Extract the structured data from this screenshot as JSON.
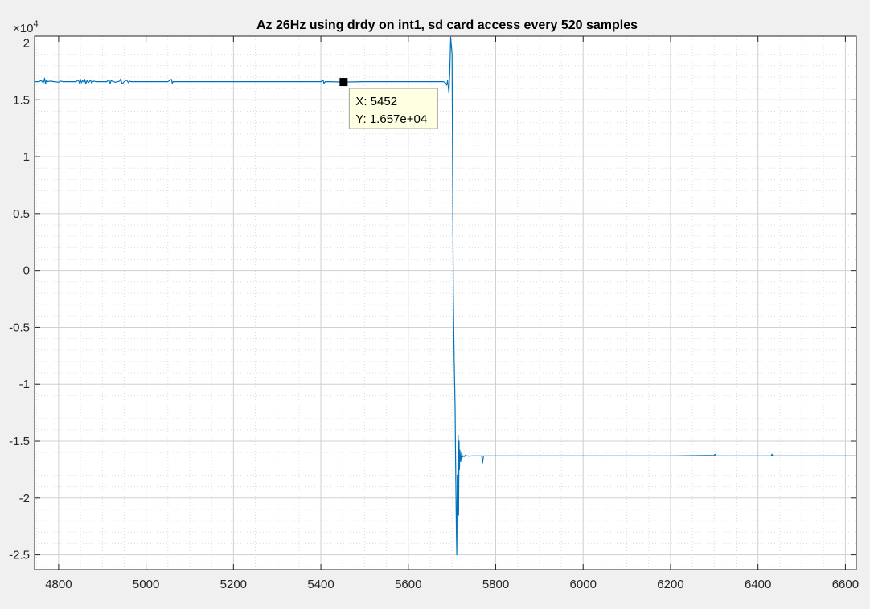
{
  "chart_data": {
    "type": "line",
    "title": "Az 26Hz using drdy on int1, sd card access every 520 samples",
    "xlabel": "",
    "ylabel": "",
    "xlim": [
      4745,
      6625
    ],
    "ylim": [
      -26300,
      20600
    ],
    "y_exponent_label": "×10",
    "y_exponent_power": "4",
    "grid": true,
    "minor_grid": true,
    "line_color": "#0072bd",
    "x_ticks": [
      4800,
      5000,
      5200,
      5400,
      5600,
      5800,
      6000,
      6200,
      6400,
      6600
    ],
    "x_tick_labels": [
      "4800",
      "5000",
      "5200",
      "5400",
      "5600",
      "5800",
      "6000",
      "6200",
      "6400",
      "6600"
    ],
    "y_ticks": [
      20000,
      15000,
      10000,
      5000,
      0,
      -5000,
      -10000,
      -15000,
      -20000,
      -25000
    ],
    "y_tick_labels": [
      "2",
      "1.5",
      "1",
      "0.5",
      "0",
      "-0.5",
      "-1",
      "-1.5",
      "-2",
      "-2.5"
    ],
    "series": [
      {
        "x": [
          4745,
          4755,
          4760,
          4765,
          4768,
          4770,
          4772,
          4775,
          4780,
          4790,
          4800,
          4805,
          4810,
          4815,
          4825,
          4840,
          4845,
          4848,
          4850,
          4852,
          4855,
          4858,
          4860,
          4862,
          4865,
          4868,
          4870,
          4873,
          4875,
          4880,
          4885,
          4900,
          4910,
          4915,
          4918,
          4920,
          4925,
          4930,
          4935,
          4940,
          4942,
          4945,
          4950,
          4955,
          4960,
          4962,
          4965,
          4970,
          4980,
          5000,
          5050,
          5058,
          5060,
          5062,
          5070,
          5100,
          5200,
          5300,
          5400,
          5405,
          5407,
          5410,
          5420,
          5452,
          5500,
          5600,
          5650,
          5680,
          5685,
          5688,
          5690,
          5693,
          5695,
          5697,
          5700,
          5701,
          5702,
          5703,
          5704,
          5705,
          5707,
          5708,
          5710,
          5711,
          5712,
          5713,
          5714,
          5715,
          5716,
          5717,
          5718,
          5720,
          5722,
          5724,
          5726,
          5728,
          5730,
          5735,
          5740,
          5745,
          5750,
          5760,
          5768,
          5770,
          5772,
          5780,
          5800,
          5900,
          6000,
          6100,
          6200,
          6300,
          6302,
          6304,
          6310,
          6400,
          6430,
          6432,
          6434,
          6440,
          6500,
          6600,
          6625
        ],
        "values": [
          16600,
          16600,
          16700,
          16500,
          16900,
          16400,
          16750,
          16600,
          16650,
          16600,
          16550,
          16650,
          16600,
          16600,
          16600,
          16600,
          16750,
          16450,
          16800,
          16500,
          16700,
          16550,
          16800,
          16400,
          16700,
          16500,
          16600,
          16750,
          16500,
          16650,
          16600,
          16600,
          16600,
          16750,
          16450,
          16700,
          16600,
          16550,
          16600,
          16650,
          16850,
          16400,
          16600,
          16750,
          16500,
          16650,
          16600,
          16600,
          16600,
          16600,
          16600,
          16800,
          16450,
          16600,
          16600,
          16600,
          16600,
          16600,
          16600,
          16750,
          16450,
          16600,
          16600,
          16570,
          16600,
          16600,
          16600,
          16600,
          16500,
          16300,
          16700,
          15600,
          17500,
          20500,
          19000,
          12000,
          5000,
          -2000,
          -5000,
          -8000,
          -12000,
          -16000,
          -23000,
          -25000,
          -18000,
          -20000,
          -14500,
          -21500,
          -15000,
          -17500,
          -15800,
          -16800,
          -16000,
          -16400,
          -16300,
          -16350,
          -16250,
          -16300,
          -16320,
          -16300,
          -16300,
          -16300,
          -16300,
          -16900,
          -16300,
          -16300,
          -16300,
          -16300,
          -16300,
          -16300,
          -16300,
          -16250,
          -16150,
          -16300,
          -16300,
          -16300,
          -16300,
          -16150,
          -16300,
          -16300,
          -16300,
          -16300,
          -16300
        ]
      }
    ],
    "datatip": {
      "x_text": "X: 5452",
      "y_text": "Y: 1.657e+04",
      "x": 5452,
      "y": 16570
    }
  }
}
